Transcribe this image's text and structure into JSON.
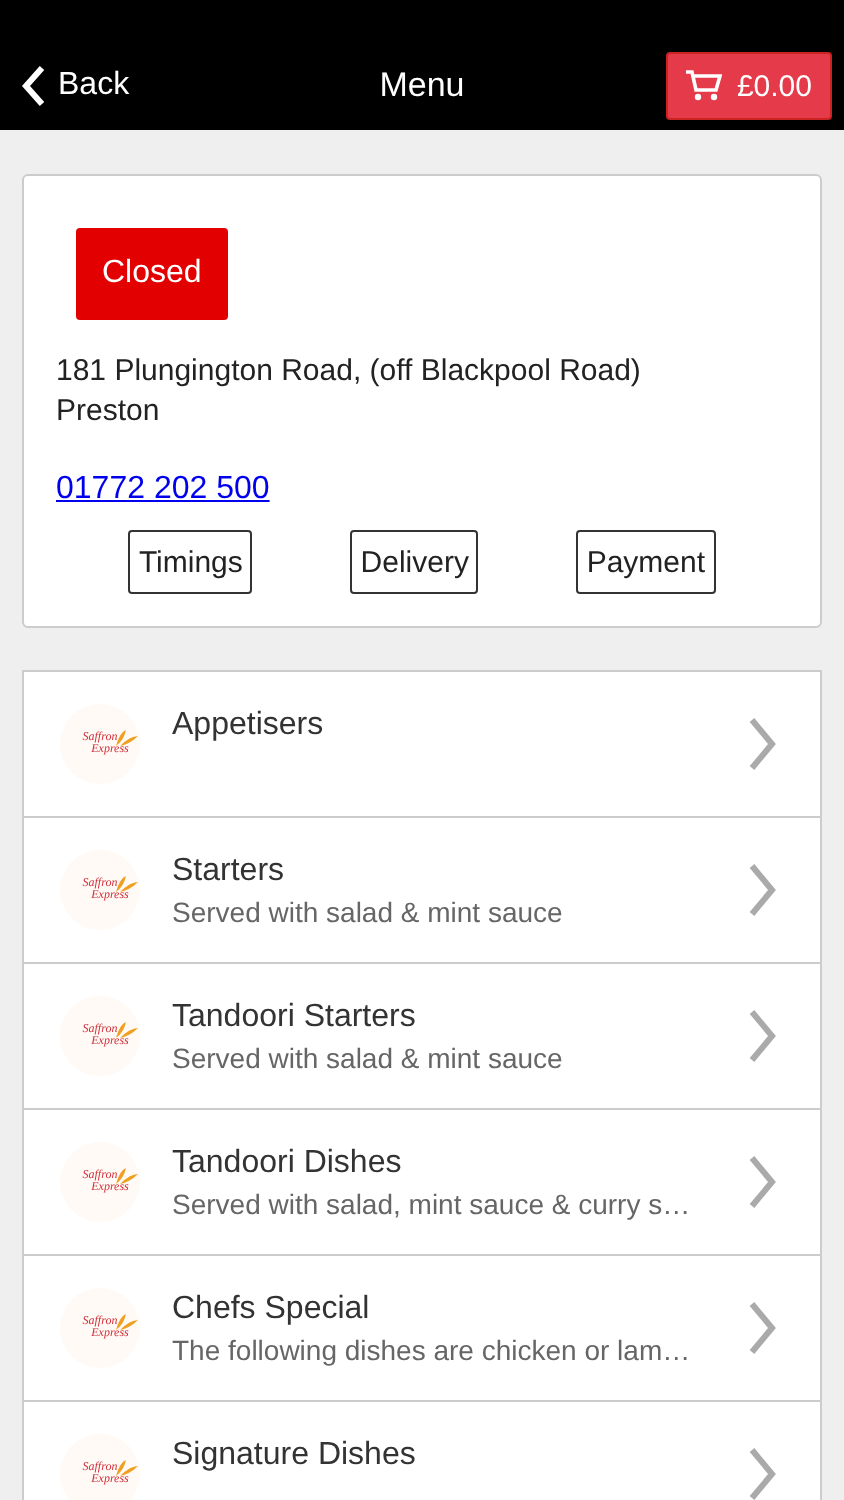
{
  "header": {
    "back": "Back",
    "title": "Menu",
    "cart_total": "£0.00"
  },
  "restaurant": {
    "status": {
      "label": "Closed",
      "open": false
    },
    "address": [
      "181 Plungington Road, (off Blackpool Road)",
      "Preston"
    ],
    "phone": "01772 202 500",
    "buttons": [
      "Timings",
      "Delivery",
      "Payment"
    ]
  },
  "categories": [
    {
      "logo": [
        "Saffron",
        "Express"
      ],
      "name": "Appetisers"
    },
    {
      "logo": [
        "Saffron",
        "Express"
      ],
      "name": "Starters",
      "description": "Served with salad & mint sauce"
    },
    {
      "logo": [
        "Saffron",
        "Express"
      ],
      "name": "Tandoori Starters",
      "description": "Served with salad & mint sauce"
    },
    {
      "logo": [
        "Saffron",
        "Express"
      ],
      "name": "Tandoori Dishes",
      "description": "Served with salad, mint sauce & curry s…"
    },
    {
      "logo": [
        "Saffron",
        "Express"
      ],
      "name": "Chefs Special",
      "description": "The following dishes are chicken or lam…"
    },
    {
      "logo": [
        "Saffron",
        "Express"
      ],
      "name": "Signature Dishes"
    }
  ]
}
